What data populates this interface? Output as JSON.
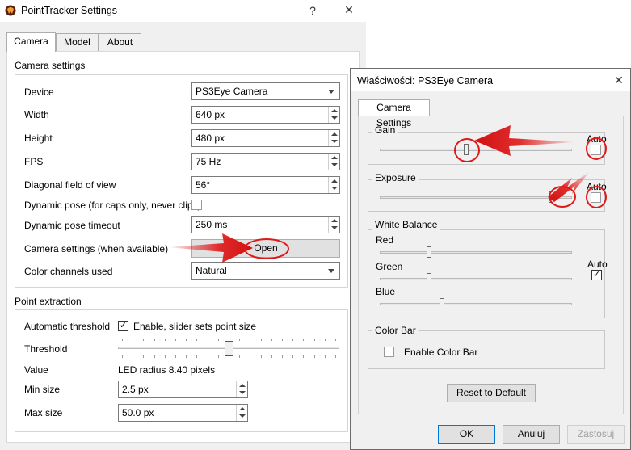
{
  "main_window": {
    "title": "PointTracker Settings",
    "help_glyph": "?",
    "close_glyph": "✕",
    "tabs": [
      "Camera",
      "Model",
      "About"
    ],
    "camera_settings": {
      "heading": "Camera settings",
      "device_label": "Device",
      "device_value": "PS3Eye Camera",
      "width_label": "Width",
      "width_value": "640 px",
      "height_label": "Height",
      "height_value": "480 px",
      "fps_label": "FPS",
      "fps_value": "75 Hz",
      "fov_label": "Diagonal field of view",
      "fov_value": "56°",
      "dynamic_pose_label": "Dynamic pose (for caps only, never clips)",
      "dynamic_pose_checked": false,
      "dynamic_pose_timeout_label": "Dynamic pose timeout",
      "dynamic_pose_timeout_value": "250 ms",
      "camera_settings_label": "Camera settings (when available)",
      "open_button": "Open",
      "color_channels_label": "Color channels used",
      "color_channels_value": "Natural"
    },
    "point_extraction": {
      "heading": "Point extraction",
      "auto_threshold_label": "Automatic threshold",
      "auto_threshold_checkbox_label": "Enable, slider sets point size",
      "auto_threshold_checked": true,
      "threshold_label": "Threshold",
      "threshold_level": 0.5,
      "value_label": "Value",
      "value_text": "LED radius 8.40 pixels",
      "min_size_label": "Min size",
      "min_size_value": "2.5 px",
      "max_size_label": "Max size",
      "max_size_value": "50.0 px"
    }
  },
  "properties_dialog": {
    "title": "Właściwości: PS3Eye Camera",
    "close_glyph": "✕",
    "tab": "Camera Settings",
    "gain": {
      "label": "Gain",
      "auto_label": "Auto",
      "auto_checked": false,
      "level": 0.45
    },
    "exposure": {
      "label": "Exposure",
      "auto_label": "Auto",
      "auto_checked": false,
      "level": 0.9
    },
    "white_balance": {
      "label": "White Balance",
      "red_label": "Red",
      "red_level": 0.25,
      "green_label": "Green",
      "green_level": 0.25,
      "blue_label": "Blue",
      "blue_level": 0.32,
      "auto_label": "Auto",
      "auto_checked": true
    },
    "color_bar": {
      "label": "Color Bar",
      "enable_label": "Enable Color Bar",
      "checked": false
    },
    "reset_button": "Reset to Default",
    "ok_button": "OK",
    "cancel_button": "Anuluj",
    "apply_button": "Zastosuj"
  },
  "colors": {
    "annotation_red": "#e01818",
    "accent": "#0078d7"
  }
}
